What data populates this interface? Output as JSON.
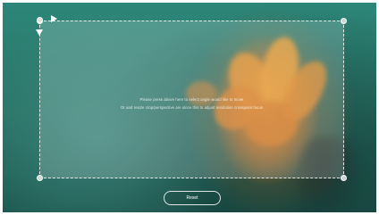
{
  "instructions": {
    "line1": "Please press above here to select angle would like to move",
    "line2": "Or and resize crop/perspective are since this to adjust resolution crosspoint focus"
  },
  "controls": {
    "reset_label": "Reset"
  },
  "icons": {
    "move_right": "arrow-right-icon",
    "move_down": "arrow-down-icon"
  },
  "colors": {
    "accent": "#ffffff",
    "flower": "#e88a28",
    "background": "#2a7a6c"
  }
}
